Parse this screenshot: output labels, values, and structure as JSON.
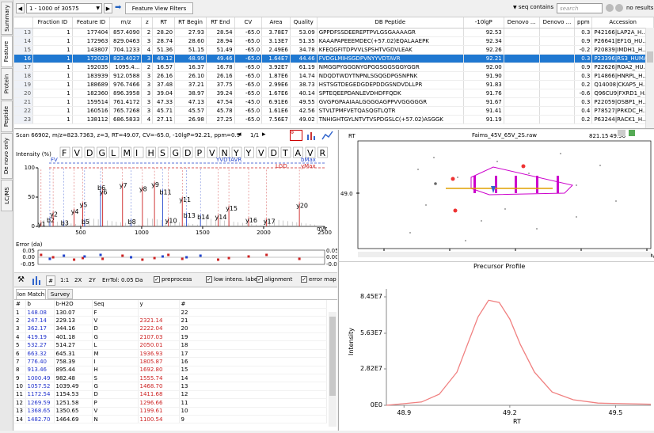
{
  "side_tabs": [
    "Summary",
    "Feature",
    "Protein",
    "Peptide",
    "De novo only",
    "LC/MS"
  ],
  "toolbar": {
    "range": "1 - 1000 of 30575",
    "filters_button": "Feature View Filters",
    "search_mode": "seq contains",
    "search_placeholder": "search",
    "result": "no results"
  },
  "table": {
    "columns": [
      "",
      "Fraction ID",
      "Feature ID",
      "m/z",
      "z",
      "RT",
      "RT Begin",
      "RT End",
      "CV",
      "Area",
      "Quality",
      "DB Peptide",
      "-10lgP",
      "Denovo ...",
      "Denovo ...",
      "ppm",
      "Accession"
    ],
    "rows": [
      [
        "13",
        "1",
        "177404",
        "857.4090",
        "2",
        "28.20",
        "27.93",
        "28.54",
        "-65.0",
        "3.78E7",
        "53.09",
        "GPPDFSSDEEREPTPVLGSGAAAAGR",
        "92.53",
        "",
        "",
        "0.3",
        "P42166|LAP2A_H..."
      ],
      [
        "14",
        "1",
        "172963",
        "829.0463",
        "3",
        "28.74",
        "28.60",
        "28.94",
        "-65.0",
        "3.13E7",
        "51.35",
        "KAAAPAPEEEMDEC(+57.02)EQALAAEPK",
        "92.34",
        "",
        "",
        "0.9",
        "P26641|EF1G_HU..."
      ],
      [
        "15",
        "1",
        "143807",
        "704.1233",
        "4",
        "51.36",
        "51.15",
        "51.49",
        "-65.0",
        "2.49E6",
        "34.78",
        "KFEQGFITDPVVLSPSHTVGDVLEAK",
        "92.26",
        "",
        "",
        "-0.2",
        "P20839|IMDH1_H..."
      ],
      [
        "16",
        "1",
        "172023",
        "823.4027",
        "3",
        "49.12",
        "48.99",
        "49.46",
        "-65.0",
        "1.64E7",
        "44.46",
        "FVDGLMIHSGDPVNYYVDTAVR",
        "92.21",
        "",
        "",
        "0.3",
        "P23396|RS3_HUMAN"
      ],
      [
        "17",
        "1",
        "192035",
        "1095.4...",
        "2",
        "16.57",
        "16.37",
        "16.78",
        "-65.0",
        "3.92E7",
        "61.19",
        "NMGGPYGGGNYGPGGSGGSGGYGGR",
        "92.00",
        "",
        "",
        "0.9",
        "P22626|ROA2_HU..."
      ],
      [
        "18",
        "1",
        "183939",
        "912.0588",
        "3",
        "26.16",
        "26.10",
        "26.16",
        "-65.0",
        "1.87E6",
        "14.74",
        "NDQDTWDYTNPNLSGQGDPGSNPNK",
        "91.90",
        "",
        "",
        "0.3",
        "P14866|HNRPL_H..."
      ],
      [
        "19",
        "1",
        "188689",
        "976.7466",
        "3",
        "37.48",
        "37.21",
        "37.75",
        "-65.0",
        "2.99E6",
        "38.73",
        "HSTSGTDEGEDGDEPDDGSNDVDLLPR",
        "91.83",
        "",
        "",
        "0.2",
        "Q14008|CKAP5_H..."
      ],
      [
        "20",
        "1",
        "182360",
        "896.3958",
        "3",
        "39.04",
        "38.97",
        "39.24",
        "-65.0",
        "1.67E6",
        "40.14",
        "SPTEQEEPDANLEVDHDFFQDK",
        "91.76",
        "",
        "",
        "-0.6",
        "Q96CU9|FXRD1_H..."
      ],
      [
        "21",
        "1",
        "159514",
        "761.4172",
        "3",
        "47.33",
        "47.13",
        "47.54",
        "-45.0",
        "6.91E6",
        "49.55",
        "GVGPGPAAIAALGGGGAGPPVVGGGGGR",
        "91.67",
        "",
        "",
        "0.3",
        "P22059|OSBP1_H..."
      ],
      [
        "22",
        "1",
        "160516",
        "765.7268",
        "3",
        "45.71",
        "45.57",
        "45.78",
        "-65.0",
        "1.61E6",
        "42.56",
        "STVLTPMFVETQASQGTLQTR",
        "91.41",
        "",
        "",
        "0.4",
        "P78527|PRKDC_H..."
      ],
      [
        "23",
        "1",
        "138112",
        "686.5833",
        "4",
        "27.11",
        "26.98",
        "27.25",
        "-65.0",
        "7.56E7",
        "49.02",
        "TNHIGHTGYLNTVTVSPDGSLC(+57.02)ASGGK",
        "91.19",
        "",
        "",
        "0.2",
        "P63244|RACK1_H..."
      ]
    ],
    "selected_row": "16"
  },
  "spectrum": {
    "header": "Scan 66902, m/z=823.7363, z=3, RT=49.07, CV=-65.0, -10lgP=92.21, ppm=0.9",
    "page": "1/1",
    "intensity_label": "Intensity (%)",
    "sequence": [
      "F",
      "V",
      "D",
      "G",
      "L",
      "M",
      "I",
      "H",
      "S",
      "G",
      "D",
      "P",
      "V",
      "N",
      "Y",
      "Y",
      "V",
      "D",
      "T",
      "A",
      "V",
      "R"
    ],
    "bmax": "bMax",
    "ymax": "yMax",
    "b_partial": "FV",
    "y_partial": "LGD",
    "seq_tag": "YVDTAVR",
    "xlabel": "m/z",
    "error_label": "Error (da)",
    "peaks": [
      {
        "label": "y1",
        "mz": 175,
        "i": 8
      },
      {
        "label": "b2",
        "mz": 247,
        "i": 15
      },
      {
        "label": "y2",
        "mz": 274,
        "i": 25
      },
      {
        "label": "b3",
        "mz": 362,
        "i": 10
      },
      {
        "label": "y4",
        "mz": 446,
        "i": 30
      },
      {
        "label": "y5",
        "mz": 517,
        "i": 41
      },
      {
        "label": "b5",
        "mz": 532,
        "i": 12
      },
      {
        "label": "b6",
        "mz": 663,
        "i": 70
      },
      {
        "label": "y6",
        "mz": 680,
        "i": 63
      },
      {
        "label": "b8",
        "mz": 913,
        "i": 12
      },
      {
        "label": "y7",
        "mz": 843,
        "i": 74
      },
      {
        "label": "y8",
        "mz": 1006,
        "i": 68
      },
      {
        "label": "y9",
        "mz": 1105,
        "i": 76
      },
      {
        "label": "b11",
        "mz": 1172,
        "i": 63
      },
      {
        "label": "y10",
        "mz": 1219,
        "i": 14
      },
      {
        "label": "y11",
        "mz": 1333,
        "i": 50
      },
      {
        "label": "b13",
        "mz": 1368,
        "i": 23
      },
      {
        "label": "b14",
        "mz": 1482,
        "i": 20
      },
      {
        "label": "y14",
        "mz": 1627,
        "i": 20
      },
      {
        "label": "y15",
        "mz": 1715,
        "i": 35
      },
      {
        "label": "y16",
        "mz": 1877,
        "i": 15
      },
      {
        "label": "y17",
        "mz": 2024,
        "i": 13
      },
      {
        "label": "y20",
        "mz": 2293,
        "i": 40
      }
    ],
    "xticks": [
      500,
      1000,
      1500,
      2000,
      2500
    ],
    "yticks": [
      0,
      50,
      100
    ],
    "err_ticks": [
      "0.05",
      "0.00",
      "-0.05"
    ]
  },
  "spec_toolbar": {
    "b1": "#",
    "b2": "1:1",
    "b3": "2X",
    "b4": "2Y",
    "tol": "ErrTol: 0.05 Da",
    "cb": [
      "preprocess",
      "low intens. label",
      "alignment",
      "error map"
    ]
  },
  "ion_tabs": [
    "Ion Match",
    "Survey"
  ],
  "ions": {
    "columns": [
      "#",
      "b",
      "b-H2O",
      "Seq",
      "y",
      "#"
    ],
    "rows": [
      [
        "1",
        "148.08",
        "130.07",
        "F",
        "",
        "22"
      ],
      [
        "2",
        "247.14",
        "229.13",
        "V",
        "2321.14",
        "21"
      ],
      [
        "3",
        "362.17",
        "344.16",
        "D",
        "2222.04",
        "20"
      ],
      [
        "4",
        "419.19",
        "401.18",
        "G",
        "2107.03",
        "19"
      ],
      [
        "5",
        "532.27",
        "514.27",
        "L",
        "2050.01",
        "18"
      ],
      [
        "6",
        "663.32",
        "645.31",
        "M",
        "1936.93",
        "17"
      ],
      [
        "7",
        "776.40",
        "758.39",
        "I",
        "1805.87",
        "16"
      ],
      [
        "8",
        "913.46",
        "895.44",
        "H",
        "1692.80",
        "15"
      ],
      [
        "9",
        "1000.49",
        "982.48",
        "S",
        "1555.74",
        "14"
      ],
      [
        "10",
        "1057.52",
        "1039.49",
        "G",
        "1468.70",
        "13"
      ],
      [
        "11",
        "1172.54",
        "1154.53",
        "D",
        "1411.68",
        "12"
      ],
      [
        "12",
        "1269.59",
        "1251.58",
        "P",
        "1296.66",
        "11"
      ],
      [
        "13",
        "1368.65",
        "1350.65",
        "V",
        "1199.61",
        "10"
      ],
      [
        "14",
        "1482.70",
        "1464.69",
        "N",
        "1100.54",
        "9"
      ]
    ]
  },
  "ms1": {
    "title": "Faims_45V_65V_2S.raw",
    "rt_label": "RT",
    "y_tick": "49.0",
    "xticks": [
      "822",
      "823",
      "824",
      "825",
      "826"
    ],
    "xlabel": "m/z",
    "readout_mz": "821.15",
    "readout_rt": "49.96"
  },
  "precursor": {
    "title": "Precursor Profile",
    "ylabel": "Intensity",
    "xlabel": "RT",
    "yticks": [
      "0E0",
      "2.82E7",
      "5.63E7",
      "8.45E7"
    ],
    "xticks": [
      "48.9",
      "49.2",
      "49.5"
    ],
    "curve_color": "#f08080",
    "points": [
      [
        48.85,
        0.0
      ],
      [
        48.95,
        0.03
      ],
      [
        49.0,
        0.1
      ],
      [
        49.05,
        0.3
      ],
      [
        49.08,
        0.55
      ],
      [
        49.11,
        0.8
      ],
      [
        49.14,
        0.95
      ],
      [
        49.17,
        0.93
      ],
      [
        49.2,
        0.78
      ],
      [
        49.23,
        0.55
      ],
      [
        49.27,
        0.3
      ],
      [
        49.32,
        0.12
      ],
      [
        49.38,
        0.05
      ],
      [
        49.45,
        0.02
      ],
      [
        49.6,
        0.01
      ]
    ]
  }
}
